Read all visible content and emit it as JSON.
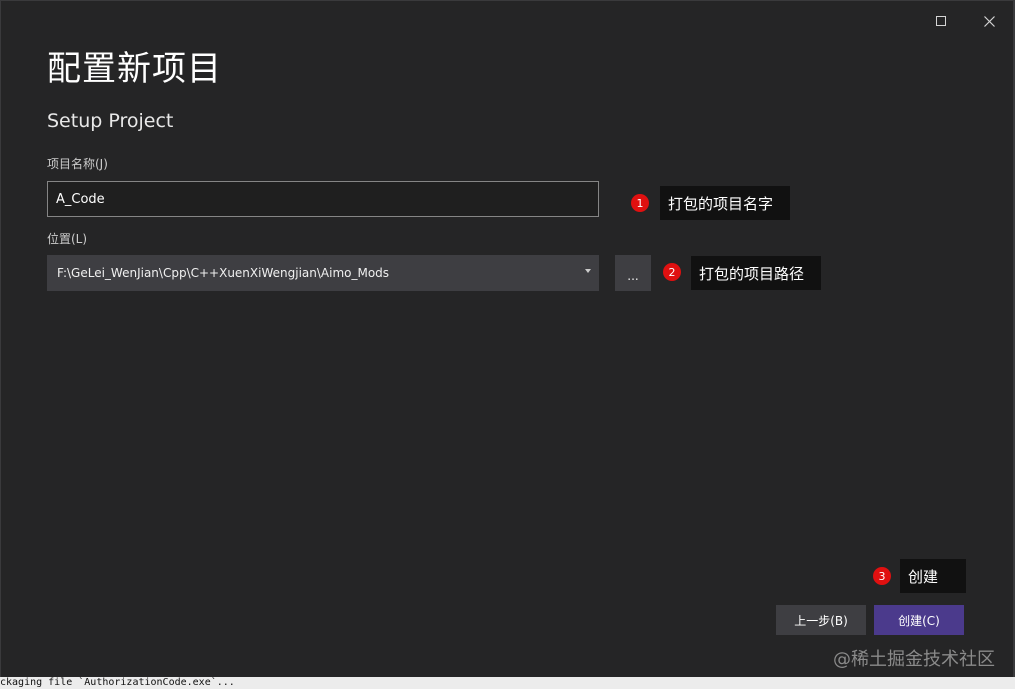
{
  "window": {
    "heading": "配置新项目",
    "subheading": "Setup Project"
  },
  "form": {
    "project_name_label": "项目名称(J)",
    "project_name_value": "A_Code",
    "location_label": "位置(L)",
    "location_value": "F:\\GeLei_WenJian\\Cpp\\C++XuenXiWengjian\\Aimo_Mods",
    "browse_label": "..."
  },
  "annotations": [
    {
      "number": "1",
      "text": "打包的项目名字"
    },
    {
      "number": "2",
      "text": "打包的项目路径"
    },
    {
      "number": "3",
      "text": "创建"
    }
  ],
  "footer": {
    "prev_label": "上一步(B)",
    "create_label": "创建(C)"
  },
  "watermark": "@稀土掘金技术社区",
  "status_text": "ckaging file `AuthorizationCode.exe`...",
  "colors": {
    "background": "#252526",
    "accent": "#4b3a8c",
    "annotation_dot": "#e01010"
  },
  "icons": {
    "maximize": "maximize-icon",
    "close": "close-icon",
    "dropdown": "chevron-down-icon"
  }
}
